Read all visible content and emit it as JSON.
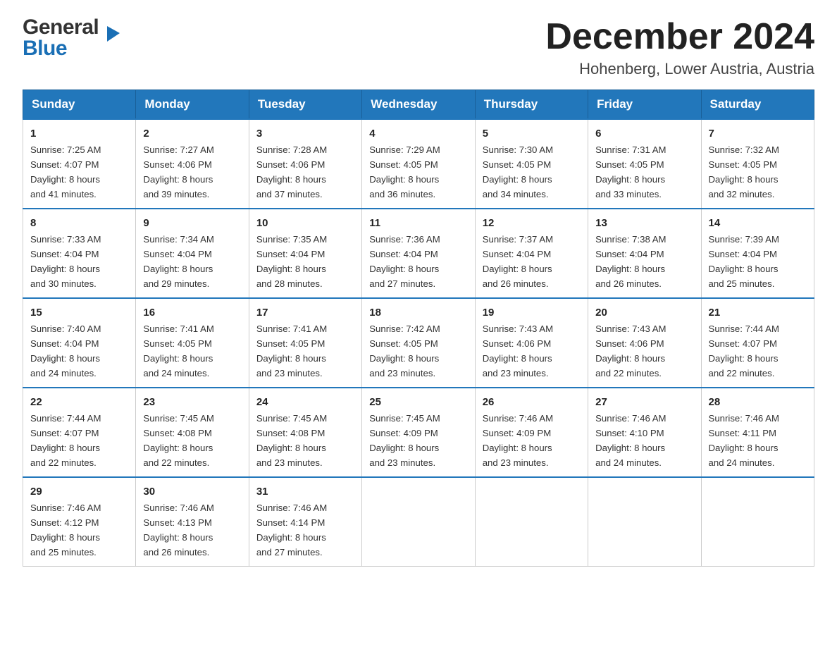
{
  "logo": {
    "general": "General",
    "blue": "Blue"
  },
  "title": "December 2024",
  "location": "Hohenberg, Lower Austria, Austria",
  "weekdays": [
    "Sunday",
    "Monday",
    "Tuesday",
    "Wednesday",
    "Thursday",
    "Friday",
    "Saturday"
  ],
  "weeks": [
    [
      {
        "day": "1",
        "sunrise": "7:25 AM",
        "sunset": "4:07 PM",
        "daylight": "8 hours and 41 minutes."
      },
      {
        "day": "2",
        "sunrise": "7:27 AM",
        "sunset": "4:06 PM",
        "daylight": "8 hours and 39 minutes."
      },
      {
        "day": "3",
        "sunrise": "7:28 AM",
        "sunset": "4:06 PM",
        "daylight": "8 hours and 37 minutes."
      },
      {
        "day": "4",
        "sunrise": "7:29 AM",
        "sunset": "4:05 PM",
        "daylight": "8 hours and 36 minutes."
      },
      {
        "day": "5",
        "sunrise": "7:30 AM",
        "sunset": "4:05 PM",
        "daylight": "8 hours and 34 minutes."
      },
      {
        "day": "6",
        "sunrise": "7:31 AM",
        "sunset": "4:05 PM",
        "daylight": "8 hours and 33 minutes."
      },
      {
        "day": "7",
        "sunrise": "7:32 AM",
        "sunset": "4:05 PM",
        "daylight": "8 hours and 32 minutes."
      }
    ],
    [
      {
        "day": "8",
        "sunrise": "7:33 AM",
        "sunset": "4:04 PM",
        "daylight": "8 hours and 30 minutes."
      },
      {
        "day": "9",
        "sunrise": "7:34 AM",
        "sunset": "4:04 PM",
        "daylight": "8 hours and 29 minutes."
      },
      {
        "day": "10",
        "sunrise": "7:35 AM",
        "sunset": "4:04 PM",
        "daylight": "8 hours and 28 minutes."
      },
      {
        "day": "11",
        "sunrise": "7:36 AM",
        "sunset": "4:04 PM",
        "daylight": "8 hours and 27 minutes."
      },
      {
        "day": "12",
        "sunrise": "7:37 AM",
        "sunset": "4:04 PM",
        "daylight": "8 hours and 26 minutes."
      },
      {
        "day": "13",
        "sunrise": "7:38 AM",
        "sunset": "4:04 PM",
        "daylight": "8 hours and 26 minutes."
      },
      {
        "day": "14",
        "sunrise": "7:39 AM",
        "sunset": "4:04 PM",
        "daylight": "8 hours and 25 minutes."
      }
    ],
    [
      {
        "day": "15",
        "sunrise": "7:40 AM",
        "sunset": "4:04 PM",
        "daylight": "8 hours and 24 minutes."
      },
      {
        "day": "16",
        "sunrise": "7:41 AM",
        "sunset": "4:05 PM",
        "daylight": "8 hours and 24 minutes."
      },
      {
        "day": "17",
        "sunrise": "7:41 AM",
        "sunset": "4:05 PM",
        "daylight": "8 hours and 23 minutes."
      },
      {
        "day": "18",
        "sunrise": "7:42 AM",
        "sunset": "4:05 PM",
        "daylight": "8 hours and 23 minutes."
      },
      {
        "day": "19",
        "sunrise": "7:43 AM",
        "sunset": "4:06 PM",
        "daylight": "8 hours and 23 minutes."
      },
      {
        "day": "20",
        "sunrise": "7:43 AM",
        "sunset": "4:06 PM",
        "daylight": "8 hours and 22 minutes."
      },
      {
        "day": "21",
        "sunrise": "7:44 AM",
        "sunset": "4:07 PM",
        "daylight": "8 hours and 22 minutes."
      }
    ],
    [
      {
        "day": "22",
        "sunrise": "7:44 AM",
        "sunset": "4:07 PM",
        "daylight": "8 hours and 22 minutes."
      },
      {
        "day": "23",
        "sunrise": "7:45 AM",
        "sunset": "4:08 PM",
        "daylight": "8 hours and 22 minutes."
      },
      {
        "day": "24",
        "sunrise": "7:45 AM",
        "sunset": "4:08 PM",
        "daylight": "8 hours and 23 minutes."
      },
      {
        "day": "25",
        "sunrise": "7:45 AM",
        "sunset": "4:09 PM",
        "daylight": "8 hours and 23 minutes."
      },
      {
        "day": "26",
        "sunrise": "7:46 AM",
        "sunset": "4:09 PM",
        "daylight": "8 hours and 23 minutes."
      },
      {
        "day": "27",
        "sunrise": "7:46 AM",
        "sunset": "4:10 PM",
        "daylight": "8 hours and 24 minutes."
      },
      {
        "day": "28",
        "sunrise": "7:46 AM",
        "sunset": "4:11 PM",
        "daylight": "8 hours and 24 minutes."
      }
    ],
    [
      {
        "day": "29",
        "sunrise": "7:46 AM",
        "sunset": "4:12 PM",
        "daylight": "8 hours and 25 minutes."
      },
      {
        "day": "30",
        "sunrise": "7:46 AM",
        "sunset": "4:13 PM",
        "daylight": "8 hours and 26 minutes."
      },
      {
        "day": "31",
        "sunrise": "7:46 AM",
        "sunset": "4:14 PM",
        "daylight": "8 hours and 27 minutes."
      },
      null,
      null,
      null,
      null
    ]
  ],
  "labels": {
    "sunrise": "Sunrise:",
    "sunset": "Sunset:",
    "daylight": "Daylight:"
  }
}
